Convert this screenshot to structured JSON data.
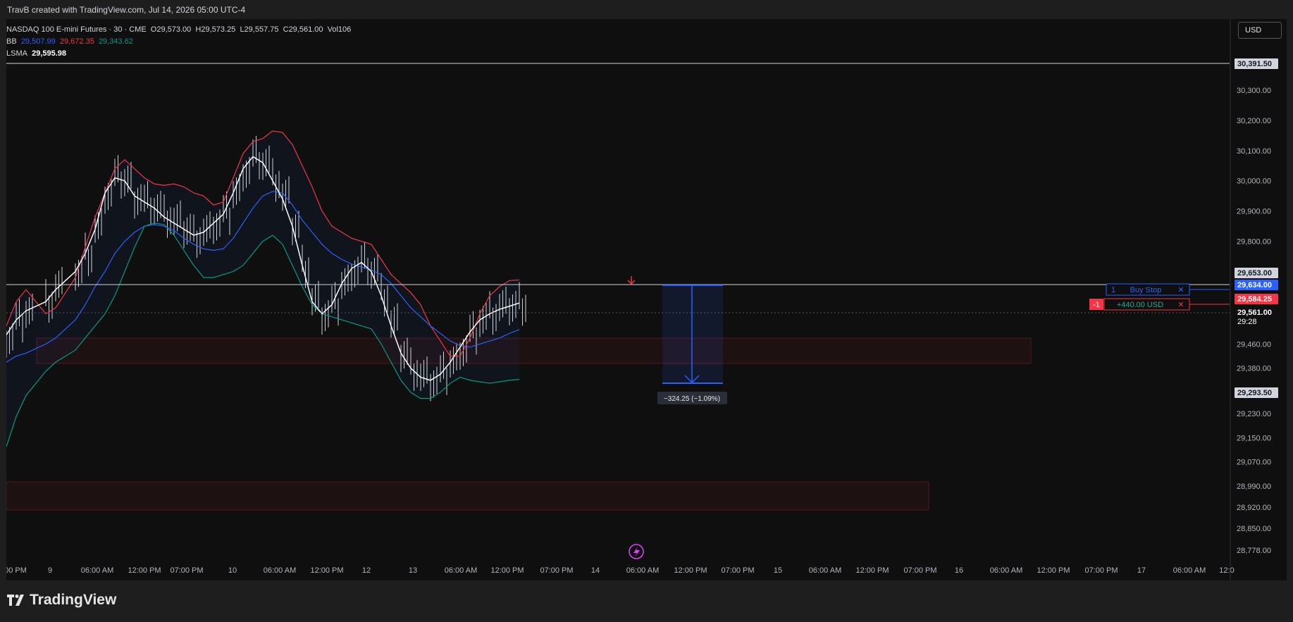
{
  "header": {
    "caption": "TravB created with TradingView.com, Jul 14, 2026 05:00 UTC-4"
  },
  "legend": {
    "symbol": "NASDAQ 100 E-mini Futures · 30 · CME",
    "open": "O29,573.00",
    "high": "H29,573.25",
    "low": "L29,557.75",
    "close": "C29,561.00",
    "volume": "Vol106",
    "bb_label": "BB",
    "bb_basis": "29,507.99",
    "bb_upper": "29,672.35",
    "bb_lower": "29,343.62",
    "lsma_label": "LSMA",
    "lsma_value": "29,595.98"
  },
  "currency_button": "USD",
  "brand": {
    "name": "TradingView"
  },
  "colors": {
    "background": "#0f0f0f",
    "bb_upper": "#f23645",
    "bb_basis": "#2962ff",
    "bb_lower": "#089981",
    "lsma": "#ffffff",
    "candle": "#d1d4dc",
    "order": "#2962ff",
    "loss": "#f23645",
    "profit": "#22ab94"
  },
  "price_labels": {
    "top_line": "30,391.50",
    "high_line": "29,653.00",
    "order_line": "29,634.00",
    "position": "29,584.25",
    "last_price": "29,561.00",
    "countdown": "29:28",
    "target": "29,293.50"
  },
  "order": {
    "qty": "1",
    "type": "Buy Stop",
    "close": "✕"
  },
  "position": {
    "qty": "-1",
    "pnl": "+440.00 USD",
    "close": "✕"
  },
  "measure": {
    "label": "−324.25 (−1.09%)"
  },
  "chart_data": {
    "type": "line",
    "title": "NASDAQ 100 E-mini Futures · 30 · CME",
    "y_ticks": [
      "30,300.00",
      "30,200.00",
      "30,100.00",
      "30,000.00",
      "29,900.00",
      "29,800.00",
      "29,460.00",
      "29,380.00",
      "29,230.00",
      "29,150.00",
      "29,070.00",
      "28,990.00",
      "28,920.00",
      "28,850.00",
      "28,778.00"
    ],
    "x_ticks": [
      "00 PM",
      "9",
      "06:00 AM",
      "12:00 PM",
      "07:00 PM",
      "10",
      "06:00 AM",
      "12:00 PM",
      "12",
      "13",
      "06:00 AM",
      "12:00 PM",
      "07:00 PM",
      "14",
      "06:00 AM",
      "12:00 PM",
      "07:00 PM",
      "15",
      "06:00 AM",
      "12:00 PM",
      "07:00 PM",
      "16",
      "06:00 AM",
      "12:00 PM",
      "07:00 PM",
      "17",
      "06:00 AM",
      "12:0"
    ],
    "ylim": [
      28750,
      30450
    ],
    "series": [
      {
        "name": "BB Upper",
        "x": [
          0,
          1,
          2,
          4,
          5,
          7,
          8,
          9,
          10,
          11,
          12,
          13,
          14,
          15,
          16,
          17,
          18,
          19,
          20,
          21,
          22,
          23,
          24,
          25,
          26,
          27,
          28,
          29,
          30,
          31,
          32,
          33,
          34,
          35,
          36,
          37,
          38,
          39,
          40,
          41,
          42,
          43,
          44,
          45,
          46,
          47,
          48,
          49,
          50,
          51,
          52
        ],
        "values": [
          29520,
          29600,
          29640,
          29560,
          29580,
          29680,
          29780,
          29880,
          29960,
          30040,
          30070,
          30040,
          30010,
          29990,
          29985,
          29990,
          29980,
          29960,
          29950,
          29920,
          29930,
          30010,
          30090,
          30130,
          30140,
          30165,
          30160,
          30120,
          30050,
          29980,
          29900,
          29850,
          29830,
          29810,
          29800,
          29790,
          29740,
          29690,
          29660,
          29630,
          29590,
          29520,
          29470,
          29420,
          29420,
          29480,
          29560,
          29620,
          29650,
          29670,
          29672
        ]
      },
      {
        "name": "BB Basis",
        "x": [
          0,
          1,
          2,
          4,
          5,
          7,
          8,
          9,
          10,
          11,
          12,
          13,
          14,
          15,
          16,
          17,
          18,
          19,
          20,
          21,
          22,
          23,
          24,
          25,
          26,
          27,
          28,
          29,
          30,
          31,
          32,
          33,
          34,
          35,
          36,
          37,
          38,
          39,
          40,
          41,
          42,
          43,
          44,
          45,
          46,
          47,
          48,
          49,
          50,
          51,
          52
        ],
        "values": [
          29400,
          29420,
          29430,
          29460,
          29480,
          29540,
          29590,
          29650,
          29700,
          29760,
          29800,
          29830,
          29850,
          29855,
          29850,
          29835,
          29810,
          29790,
          29775,
          29770,
          29775,
          29810,
          29860,
          29910,
          29950,
          29965,
          29960,
          29920,
          29870,
          29830,
          29790,
          29760,
          29740,
          29725,
          29715,
          29705,
          29690,
          29660,
          29620,
          29580,
          29550,
          29520,
          29495,
          29470,
          29455,
          29450,
          29460,
          29470,
          29480,
          29495,
          29508
        ]
      },
      {
        "name": "BB Lower",
        "x": [
          0,
          1,
          2,
          4,
          5,
          7,
          8,
          9,
          10,
          11,
          12,
          13,
          14,
          15,
          16,
          17,
          18,
          19,
          20,
          21,
          22,
          23,
          24,
          25,
          26,
          27,
          28,
          29,
          30,
          31,
          32,
          33,
          34,
          35,
          36,
          37,
          38,
          39,
          40,
          41,
          42,
          43,
          44,
          45,
          46,
          47,
          48,
          49,
          50,
          51,
          52
        ],
        "values": [
          29120,
          29220,
          29290,
          29370,
          29400,
          29440,
          29480,
          29520,
          29560,
          29620,
          29700,
          29780,
          29850,
          29860,
          29855,
          29820,
          29770,
          29720,
          29680,
          29680,
          29690,
          29700,
          29720,
          29760,
          29800,
          29820,
          29790,
          29720,
          29650,
          29590,
          29560,
          29550,
          29540,
          29530,
          29520,
          29510,
          29460,
          29400,
          29340,
          29300,
          29280,
          29280,
          29300,
          29330,
          29350,
          29340,
          29335,
          29330,
          29335,
          29340,
          29343
        ]
      },
      {
        "name": "LSMA",
        "x": [
          0,
          1,
          2,
          4,
          5,
          7,
          8,
          9,
          10,
          11,
          12,
          13,
          14,
          15,
          16,
          17,
          18,
          19,
          20,
          21,
          22,
          23,
          24,
          25,
          26,
          27,
          28,
          29,
          30,
          31,
          32,
          33,
          34,
          35,
          36,
          37,
          38,
          39,
          40,
          41,
          42,
          43,
          44,
          45,
          46,
          47,
          48,
          49,
          50,
          51,
          52
        ],
        "values": [
          29490,
          29540,
          29570,
          29600,
          29640,
          29700,
          29760,
          29840,
          29960,
          30010,
          30000,
          29950,
          29930,
          29910,
          29880,
          29860,
          29840,
          29820,
          29830,
          29860,
          29890,
          29960,
          30040,
          30080,
          30060,
          30000,
          29940,
          29850,
          29720,
          29600,
          29560,
          29590,
          29660,
          29710,
          29730,
          29700,
          29620,
          29520,
          29430,
          29380,
          29350,
          29340,
          29360,
          29400,
          29450,
          29500,
          29540,
          29560,
          29575,
          29585,
          29596
        ]
      }
    ]
  }
}
